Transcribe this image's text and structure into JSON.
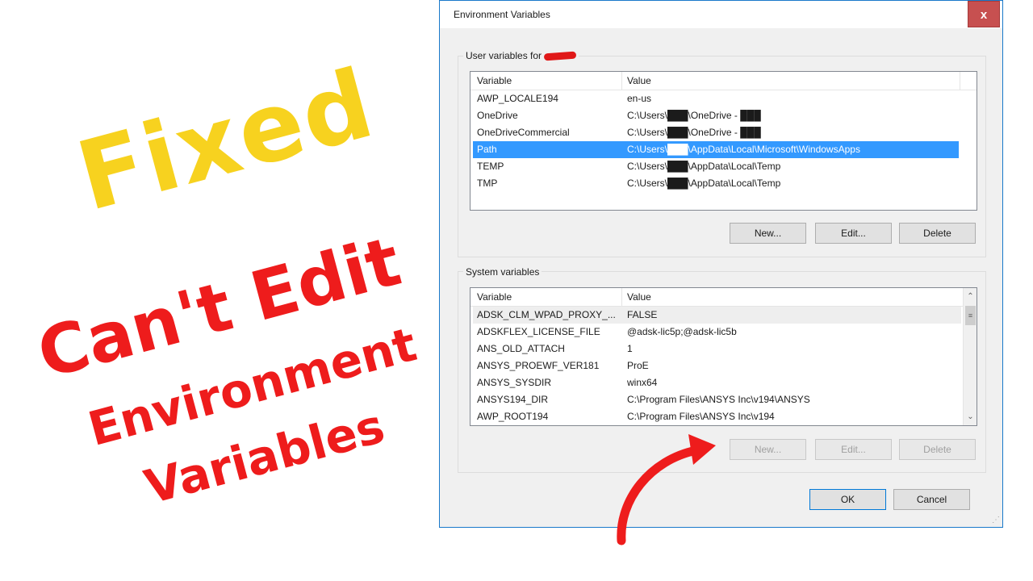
{
  "overlay": {
    "fixed": "Fixed",
    "cant_edit": "Can't Edit",
    "environment": "Environment",
    "variables": "Variables"
  },
  "dialog": {
    "title": "Environment Variables",
    "close_label": "x",
    "user_group_label": "User variables for",
    "system_group_label": "System variables",
    "columns": [
      "Variable",
      "Value"
    ],
    "user_vars": [
      {
        "name": "AWP_LOCALE194",
        "value": "en-us"
      },
      {
        "name": "OneDrive",
        "value": "C:\\Users\\███\\OneDrive - ███"
      },
      {
        "name": "OneDriveCommercial",
        "value": "C:\\Users\\███\\OneDrive - ███"
      },
      {
        "name": "Path",
        "value": "C:\\Users\\███\\AppData\\Local\\Microsoft\\WindowsApps"
      },
      {
        "name": "TEMP",
        "value": "C:\\Users\\███\\AppData\\Local\\Temp"
      },
      {
        "name": "TMP",
        "value": "C:\\Users\\███\\AppData\\Local\\Temp"
      }
    ],
    "user_selected_index": 3,
    "system_vars": [
      {
        "name": "ADSK_CLM_WPAD_PROXY_...",
        "value": "FALSE"
      },
      {
        "name": "ADSKFLEX_LICENSE_FILE",
        "value": "@adsk-lic5p;@adsk-lic5b"
      },
      {
        "name": "ANS_OLD_ATTACH",
        "value": "1"
      },
      {
        "name": "ANSYS_PROEWF_VER181",
        "value": "ProE"
      },
      {
        "name": "ANSYS_SYSDIR",
        "value": "winx64"
      },
      {
        "name": "ANSYS194_DIR",
        "value": "C:\\Program Files\\ANSYS Inc\\v194\\ANSYS"
      },
      {
        "name": "AWP_ROOT194",
        "value": "C:\\Program Files\\ANSYS Inc\\v194"
      }
    ],
    "user_buttons": {
      "new": "New...",
      "edit": "Edit...",
      "delete": "Delete"
    },
    "system_buttons": {
      "new": "New...",
      "edit": "Edit...",
      "delete": "Delete"
    },
    "ok": "OK",
    "cancel": "Cancel",
    "colors": {
      "accent": "#3399ff",
      "close": "#c75050",
      "overlay_yellow": "#f7d21f",
      "overlay_red": "#ee1c1c"
    }
  }
}
